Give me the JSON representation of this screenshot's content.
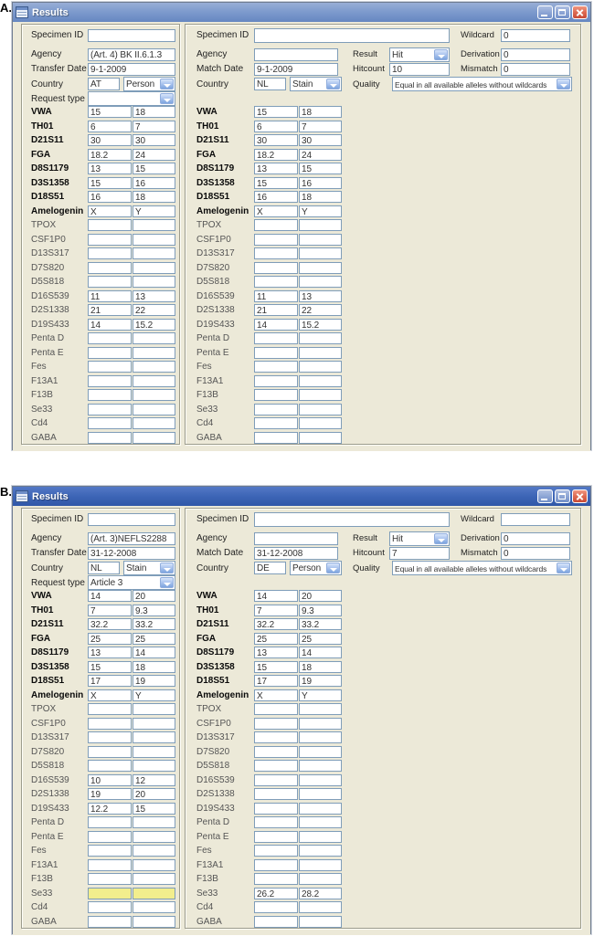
{
  "colors": {
    "client_bg": "#ece9d8",
    "titlebar_a": "#7e9bcd",
    "titlebar_b": "#3d65b6",
    "field_border": "#7f9db9",
    "close_button_red": "#c74a36",
    "highlight_yellow": "#f2ee8d",
    "redaction_black": "#0b0b0b"
  },
  "loci": [
    {
      "name": "VWA",
      "bold": true
    },
    {
      "name": "TH01",
      "bold": true
    },
    {
      "name": "D21S11",
      "bold": true
    },
    {
      "name": "FGA",
      "bold": true
    },
    {
      "name": "D8S1179",
      "bold": true
    },
    {
      "name": "D3S1358",
      "bold": true
    },
    {
      "name": "D18S51",
      "bold": true
    },
    {
      "name": "Amelogenin",
      "bold": true
    },
    {
      "name": "TPOX",
      "bold": false
    },
    {
      "name": "CSF1P0",
      "bold": false
    },
    {
      "name": "D13S317",
      "bold": false
    },
    {
      "name": "D7S820",
      "bold": false
    },
    {
      "name": "D5S818",
      "bold": false
    },
    {
      "name": "D16S539",
      "bold": false
    },
    {
      "name": "D2S1338",
      "bold": false
    },
    {
      "name": "D19S433",
      "bold": false
    },
    {
      "name": "Penta D",
      "bold": false
    },
    {
      "name": "Penta E",
      "bold": false
    },
    {
      "name": "Fes",
      "bold": false
    },
    {
      "name": "F13A1",
      "bold": false
    },
    {
      "name": "F13B",
      "bold": false
    },
    {
      "name": "Se33",
      "bold": false
    },
    {
      "name": "Cd4",
      "bold": false
    },
    {
      "name": "GABA",
      "bold": false
    }
  ],
  "windows": [
    {
      "figure_label": "A.",
      "title": "Results",
      "left_panel": {
        "specimen_label": "Specimen ID",
        "specimen_value": "",
        "specimen_redacted": true,
        "agency_label": "Agency",
        "agency_value": "(Art. 4) BK II.6.1.3",
        "date_label": "Transfer Date",
        "date_value": "9-1-2009",
        "country_label": "Country",
        "country_code": "AT",
        "country_type": "Person",
        "request_label": "Request type",
        "request_value": "",
        "alleles": {
          "VWA": [
            "15",
            "18"
          ],
          "TH01": [
            "6",
            "7"
          ],
          "D21S11": [
            "30",
            "30"
          ],
          "FGA": [
            "18.2",
            "24"
          ],
          "D8S1179": [
            "13",
            "15"
          ],
          "D3S1358": [
            "15",
            "16"
          ],
          "D18S51": [
            "16",
            "18"
          ],
          "Amelogenin": [
            "X",
            "Y"
          ],
          "D16S539": [
            "11",
            "13"
          ],
          "D2S1338": [
            "21",
            "22"
          ],
          "D19S433": [
            "14",
            "15.2"
          ]
        },
        "highlighted": []
      },
      "right_panel": {
        "specimen_label": "Specimen ID",
        "specimen_value": "",
        "specimen_redacted": true,
        "specimen_spinner": true,
        "agency_label": "Agency",
        "agency_value": "",
        "date_label": "Match Date",
        "date_value": "9-1-2009",
        "country_label": "Country",
        "country_code": "NL",
        "country_type": "Stain",
        "result_label": "Result",
        "result_value": "Hit",
        "hitcount_label": "Hitcount",
        "hitcount_value": "10",
        "quality_label": "Quality",
        "quality_value": "Equal in all available alleles without wildcards",
        "wildcard_label": "Wildcard",
        "wildcard_value": "0",
        "derivation_label": "Derivation",
        "derivation_value": "0",
        "mismatch_label": "Mismatch",
        "mismatch_value": "0",
        "alleles": {
          "VWA": [
            "15",
            "18"
          ],
          "TH01": [
            "6",
            "7"
          ],
          "D21S11": [
            "30",
            "30"
          ],
          "FGA": [
            "18.2",
            "24"
          ],
          "D8S1179": [
            "13",
            "15"
          ],
          "D3S1358": [
            "15",
            "16"
          ],
          "D18S51": [
            "16",
            "18"
          ],
          "Amelogenin": [
            "X",
            "Y"
          ],
          "D16S539": [
            "11",
            "13"
          ],
          "D2S1338": [
            "21",
            "22"
          ],
          "D19S433": [
            "14",
            "15.2"
          ]
        },
        "highlighted": []
      }
    },
    {
      "figure_label": "B.",
      "title": "Results",
      "left_panel": {
        "specimen_label": "Specimen ID",
        "specimen_value": "",
        "specimen_redacted": true,
        "agency_label": "Agency",
        "agency_value": "(Art. 3)NEFLS2288",
        "date_label": "Transfer Date",
        "date_value": "31-12-2008",
        "country_label": "Country",
        "country_code": "NL",
        "country_type": "Stain",
        "request_label": "Request type",
        "request_value": "Article 3",
        "alleles": {
          "VWA": [
            "14",
            "20"
          ],
          "TH01": [
            "7",
            "9.3"
          ],
          "D21S11": [
            "32.2",
            "33.2"
          ],
          "FGA": [
            "25",
            "25"
          ],
          "D8S1179": [
            "13",
            "14"
          ],
          "D3S1358": [
            "15",
            "18"
          ],
          "D18S51": [
            "17",
            "19"
          ],
          "Amelogenin": [
            "X",
            "Y"
          ],
          "D16S539": [
            "10",
            "12"
          ],
          "D2S1338": [
            "19",
            "20"
          ],
          "D19S433": [
            "12.2",
            "15"
          ]
        },
        "highlighted": [
          "Se33"
        ]
      },
      "right_panel": {
        "specimen_label": "Specimen ID",
        "specimen_value": "",
        "specimen_redacted": true,
        "specimen_spinner": false,
        "agency_label": "Agency",
        "agency_value": "",
        "date_label": "Match Date",
        "date_value": "31-12-2008",
        "country_label": "Country",
        "country_code": "DE",
        "country_type": "Person",
        "result_label": "Result",
        "result_value": "Hit",
        "hitcount_label": "Hitcount",
        "hitcount_value": "7",
        "quality_label": "Quality",
        "quality_value": "Equal in all available alleles without wildcards",
        "wildcard_label": "Wildcard",
        "wildcard_value": "",
        "wildcard_cursor": true,
        "derivation_label": "Derivation",
        "derivation_value": "0",
        "mismatch_label": "Mismatch",
        "mismatch_value": "0",
        "alleles": {
          "VWA": [
            "14",
            "20"
          ],
          "TH01": [
            "7",
            "9.3"
          ],
          "D21S11": [
            "32.2",
            "33.2"
          ],
          "FGA": [
            "25",
            "25"
          ],
          "D8S1179": [
            "13",
            "14"
          ],
          "D3S1358": [
            "15",
            "18"
          ],
          "D18S51": [
            "17",
            "19"
          ],
          "Amelogenin": [
            "X",
            "Y"
          ],
          "Se33": [
            "26.2",
            "28.2"
          ]
        },
        "highlighted": []
      }
    }
  ]
}
